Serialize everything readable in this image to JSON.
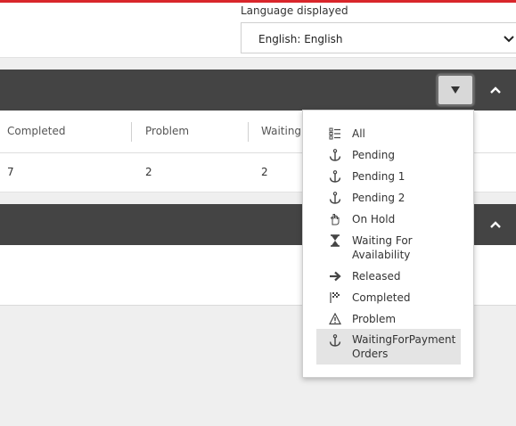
{
  "header": {
    "language_label": "Language displayed",
    "language_value": "English: English"
  },
  "panel1": {
    "columns": [
      "Completed",
      "Problem",
      "WaitingF"
    ],
    "values": [
      "7",
      "2",
      "2"
    ]
  },
  "dropdown": {
    "items": [
      {
        "label": "All",
        "icon": "checklist-icon"
      },
      {
        "label": "Pending",
        "icon": "anchor-icon"
      },
      {
        "label": "Pending 1",
        "icon": "anchor-icon"
      },
      {
        "label": "Pending 2",
        "icon": "anchor-icon"
      },
      {
        "label": "On Hold",
        "icon": "hand-icon"
      },
      {
        "label": "Waiting For Availability",
        "icon": "hourglass-icon"
      },
      {
        "label": "Released",
        "icon": "arrow-right-icon"
      },
      {
        "label": "Completed",
        "icon": "checkered-flag-icon"
      },
      {
        "label": "Problem",
        "icon": "warning-icon"
      },
      {
        "label": "WaitingForPaymentOrders",
        "icon": "anchor-icon"
      }
    ],
    "selected_index": 9
  },
  "colors": {
    "accent_top_bar": "#d9262b",
    "panel_bar": "#444444",
    "selected_item_bg": "#e4e4e4"
  }
}
